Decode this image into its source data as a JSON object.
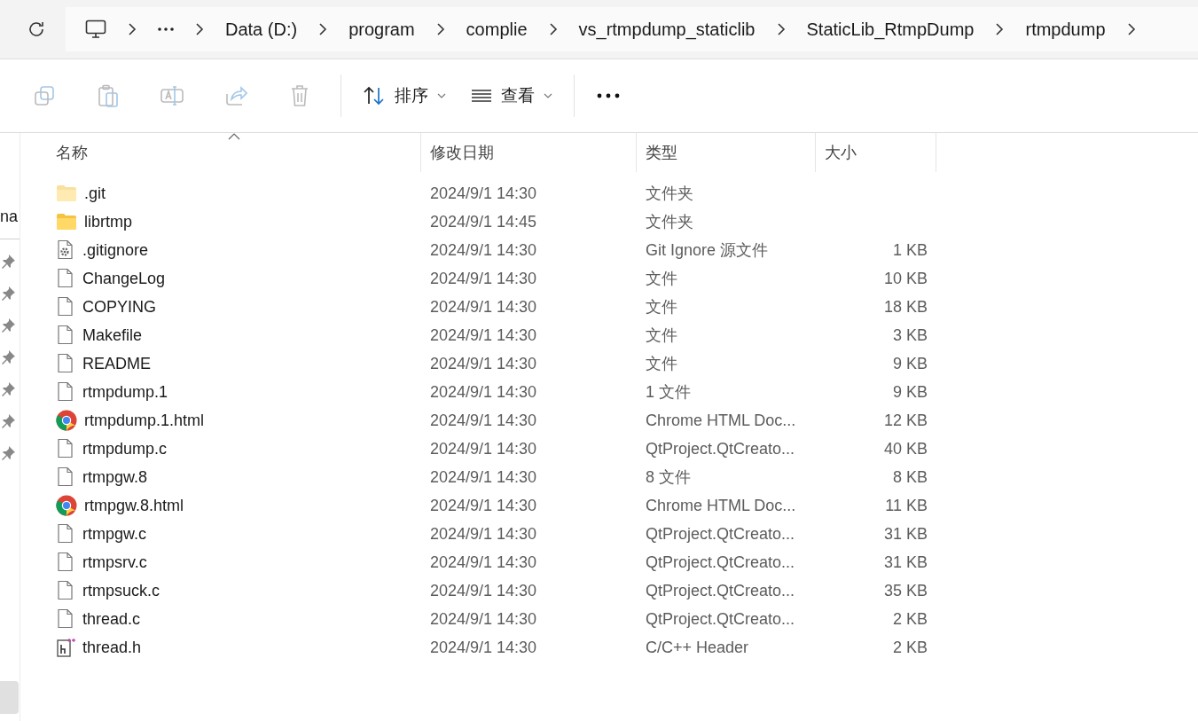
{
  "address_bar": {
    "crumbs": [
      {
        "kind": "computer"
      },
      {
        "kind": "chevron"
      },
      {
        "kind": "overflow"
      },
      {
        "kind": "chevron"
      },
      {
        "kind": "text",
        "label": "Data (D:)"
      },
      {
        "kind": "chevron"
      },
      {
        "kind": "text",
        "label": "program"
      },
      {
        "kind": "chevron"
      },
      {
        "kind": "text",
        "label": "complie"
      },
      {
        "kind": "chevron"
      },
      {
        "kind": "text",
        "label": "vs_rtmpdump_staticlib"
      },
      {
        "kind": "chevron"
      },
      {
        "kind": "text",
        "label": "StaticLib_RtmpDump"
      },
      {
        "kind": "chevron"
      },
      {
        "kind": "text",
        "label": "rtmpdump"
      },
      {
        "kind": "chevron"
      }
    ]
  },
  "toolbar": {
    "actions": [
      {
        "kind": "copy",
        "disabled": true
      },
      {
        "kind": "paste",
        "disabled": true
      },
      {
        "kind": "rename",
        "disabled": true
      },
      {
        "kind": "share",
        "disabled": true
      },
      {
        "kind": "delete",
        "disabled": true
      }
    ],
    "menus": [
      {
        "kind": "sort",
        "label": "排序"
      },
      {
        "kind": "view",
        "label": "查看"
      }
    ]
  },
  "sidebar": {
    "partial_label": "na",
    "pins": [
      {
        "pinned": true
      },
      {
        "pinned": true
      },
      {
        "pinned": true
      },
      {
        "pinned": true
      },
      {
        "pinned": true
      },
      {
        "pinned": true
      },
      {
        "pinned": true
      }
    ],
    "selected_item": {
      "selected": true
    }
  },
  "table": {
    "columns": [
      {
        "label": "名称",
        "sorted": true
      },
      {
        "label": "修改日期",
        "sorted": false
      },
      {
        "label": "类型",
        "sorted": false
      },
      {
        "label": "大小",
        "sorted": false
      }
    ],
    "rows": [
      {
        "kind": "folder",
        "hidden": true,
        "name": ".git",
        "date": "2024/9/1 14:30",
        "type": "文件夹"
      },
      {
        "kind": "folder",
        "hidden": false,
        "name": "librtmp",
        "date": "2024/9/1 14:45",
        "type": "文件夹"
      },
      {
        "kind": "config",
        "name": ".gitignore",
        "date": "2024/9/1 14:30",
        "type": "Git Ignore 源文件",
        "size": "1 KB"
      },
      {
        "kind": "file",
        "name": "ChangeLog",
        "date": "2024/9/1 14:30",
        "type": "文件",
        "size": "10 KB"
      },
      {
        "kind": "file",
        "name": "COPYING",
        "date": "2024/9/1 14:30",
        "type": "文件",
        "size": "18 KB"
      },
      {
        "kind": "file",
        "name": "Makefile",
        "date": "2024/9/1 14:30",
        "type": "文件",
        "size": "3 KB"
      },
      {
        "kind": "file",
        "name": "README",
        "date": "2024/9/1 14:30",
        "type": "文件",
        "size": "9 KB"
      },
      {
        "kind": "file",
        "name": "rtmpdump.1",
        "date": "2024/9/1 14:30",
        "type": "1 文件",
        "size": "9 KB"
      },
      {
        "kind": "browser",
        "name": "rtmpdump.1.html",
        "date": "2024/9/1 14:30",
        "type": "Chrome HTML Doc...",
        "size": "12 KB"
      },
      {
        "kind": "file",
        "name": "rtmpdump.c",
        "date": "2024/9/1 14:30",
        "type": "QtProject.QtCreato...",
        "size": "40 KB"
      },
      {
        "kind": "file",
        "name": "rtmpgw.8",
        "date": "2024/9/1 14:30",
        "type": "8 文件",
        "size": "8 KB"
      },
      {
        "kind": "browser",
        "name": "rtmpgw.8.html",
        "date": "2024/9/1 14:30",
        "type": "Chrome HTML Doc...",
        "size": "11 KB"
      },
      {
        "kind": "file",
        "name": "rtmpgw.c",
        "date": "2024/9/1 14:30",
        "type": "QtProject.QtCreato...",
        "size": "31 KB"
      },
      {
        "kind": "file",
        "name": "rtmpsrv.c",
        "date": "2024/9/1 14:30",
        "type": "QtProject.QtCreato...",
        "size": "31 KB"
      },
      {
        "kind": "file",
        "name": "rtmpsuck.c",
        "date": "2024/9/1 14:30",
        "type": "QtProject.QtCreato...",
        "size": "35 KB"
      },
      {
        "kind": "file",
        "name": "thread.c",
        "date": "2024/9/1 14:30",
        "type": "QtProject.QtCreato...",
        "size": "2 KB"
      },
      {
        "kind": "header",
        "name": "thread.h",
        "date": "2024/9/1 14:30",
        "type": "C/C++ Header",
        "size": "2 KB"
      }
    ]
  }
}
